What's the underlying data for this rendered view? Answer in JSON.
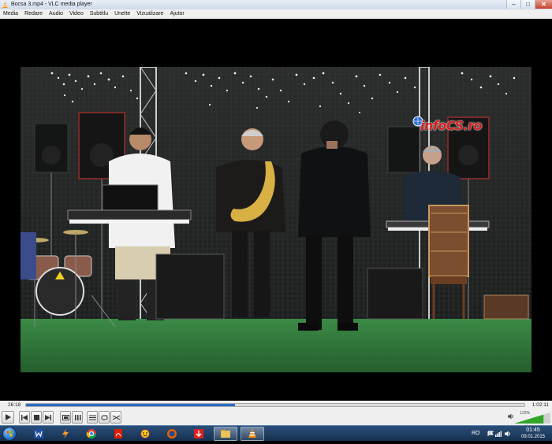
{
  "window": {
    "title": "Bocsa 3.mp4 - VLC media player",
    "min_glyph": "–",
    "max_glyph": "□",
    "close_glyph": "✕"
  },
  "menu": [
    {
      "id": "media",
      "label": "Media"
    },
    {
      "id": "redare",
      "label": "Redare"
    },
    {
      "id": "audio",
      "label": "Audio"
    },
    {
      "id": "video",
      "label": "Video"
    },
    {
      "id": "subtitlu",
      "label": "Subtitlu"
    },
    {
      "id": "unelte",
      "label": "Unelte"
    },
    {
      "id": "vizualizare",
      "label": "Vizualizare"
    },
    {
      "id": "ajutor",
      "label": "Ajutor"
    }
  ],
  "video": {
    "watermark": "infoCS.ro"
  },
  "player": {
    "elapsed": "26:18",
    "total": "1:02:11",
    "progress_fraction": 0.42,
    "volume_percent_label": "122%",
    "volume_fraction": 0.81
  },
  "taskbar": {
    "apps": [
      "windows-explorer",
      "word",
      "winamp",
      "chrome",
      "acrobat-reader",
      "messenger",
      "firefox",
      "download-manager",
      "file-manager",
      "vlc"
    ],
    "language": "RO",
    "time": "01:45",
    "date": "09.01.2015"
  },
  "colors": {
    "progress": "#2a6cc4",
    "watermark": "#d21e1e",
    "stage_floor": "#2f7a3a"
  }
}
